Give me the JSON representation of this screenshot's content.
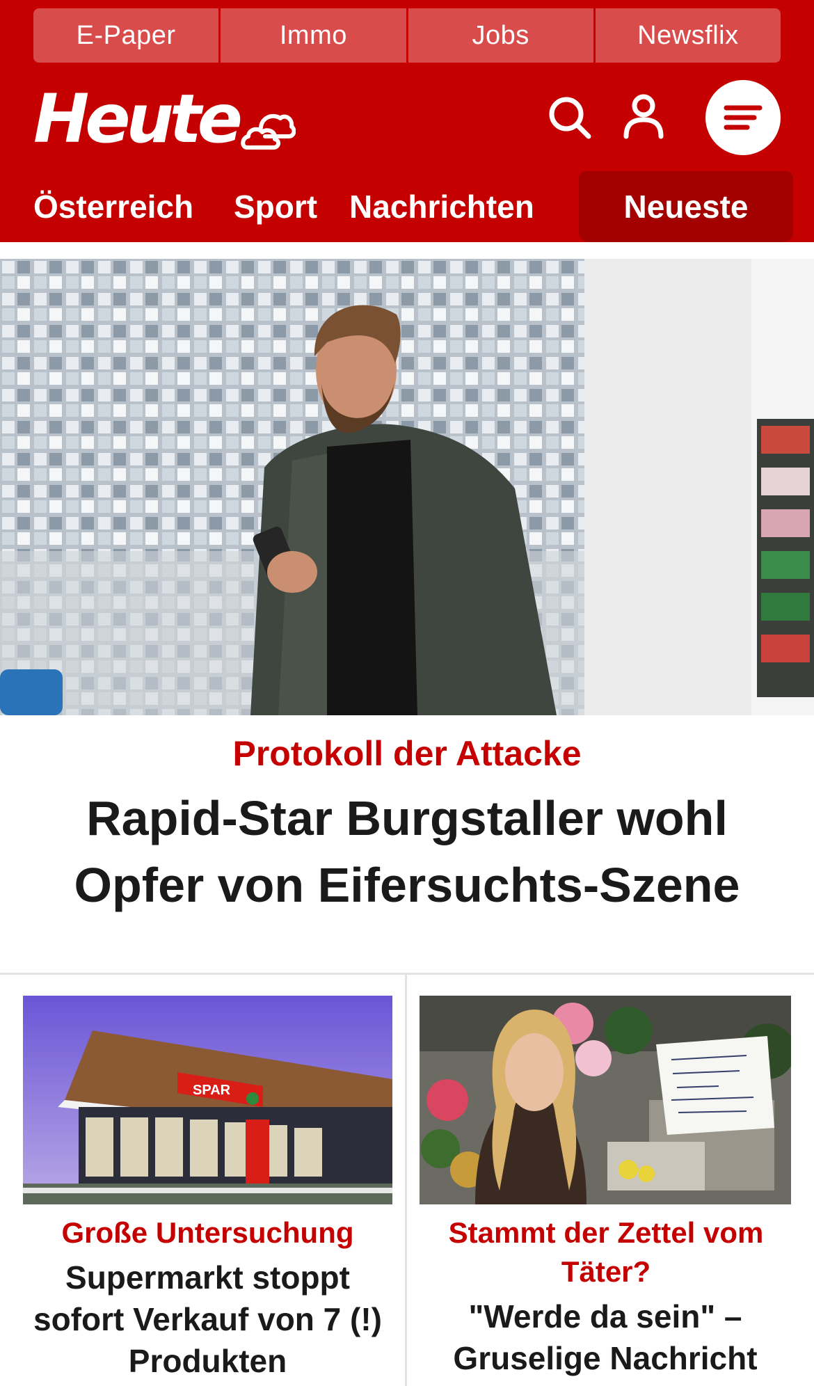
{
  "service_bar": [
    "E-Paper",
    "Immo",
    "Jobs",
    "Newsflix"
  ],
  "brand": {
    "logo": "Heute",
    "weather_icon": "cloud-sun-icon"
  },
  "header_icons": [
    "search-icon",
    "user-icon",
    "menu-icon"
  ],
  "nav": {
    "tabs": [
      "Österreich",
      "Sport",
      "Nachrichten"
    ],
    "active_tab": "Neueste"
  },
  "colors": {
    "brand_red": "#c40000",
    "dark_red": "#a30000",
    "text": "#1a1a1a"
  },
  "hero": {
    "kicker": "Protokoll der Attacke",
    "title": "Rapid-Star Burgstaller wohl Opfer von Eifersuchts-Szene"
  },
  "cards": [
    {
      "image_sign": "SPAR",
      "kicker": "Große Untersuchung",
      "title": "Supermarkt stoppt sofort Verkauf von 7 (!) Produkten"
    },
    {
      "kicker": "Stammt der Zettel vom Täter?",
      "title": "\"Werde da sein\" – Gruselige Nachricht"
    }
  ]
}
